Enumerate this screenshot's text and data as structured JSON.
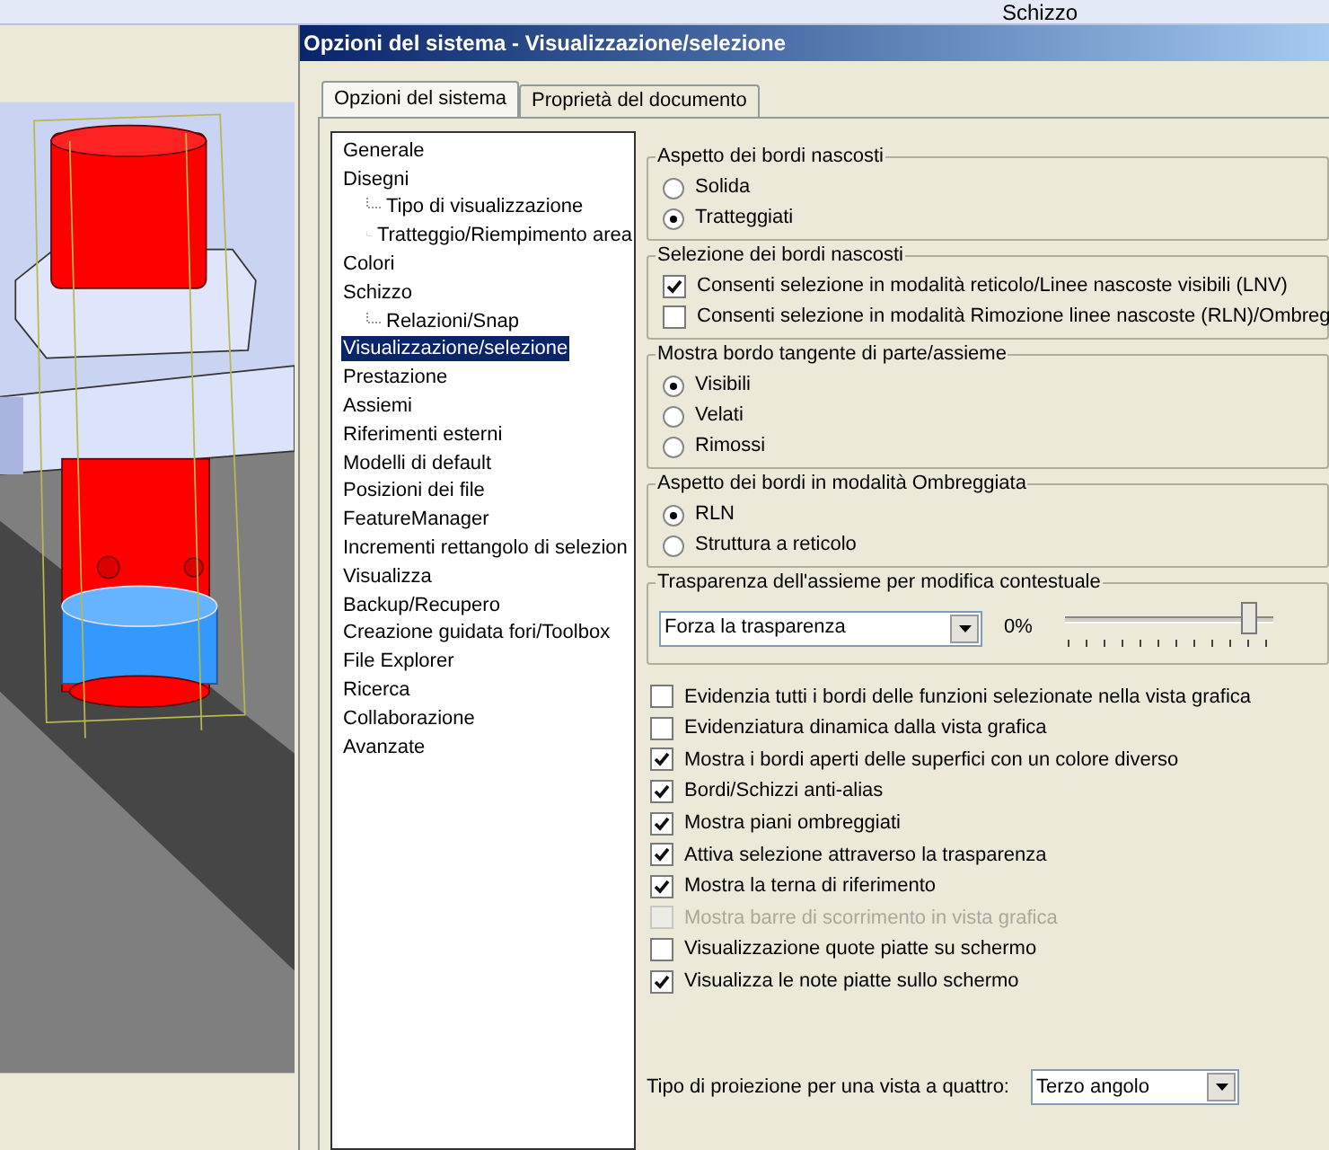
{
  "toolbar": {
    "mode_label": "Schizzo"
  },
  "dialog": {
    "title": "Opzioni del sistema - Visualizzazione/selezione",
    "tabs": [
      {
        "label": "Opzioni del sistema",
        "selected": true
      },
      {
        "label": "Proprietà del documento",
        "selected": false
      }
    ],
    "tree": [
      {
        "label": "Generale",
        "selected": false
      },
      {
        "label": "Disegni",
        "selected": false,
        "children": [
          {
            "label": "Tipo di visualizzazione",
            "selected": false
          },
          {
            "label": "Tratteggio/Riempimento area",
            "selected": false
          }
        ]
      },
      {
        "label": "Colori",
        "selected": false
      },
      {
        "label": "Schizzo",
        "selected": false,
        "children": [
          {
            "label": "Relazioni/Snap",
            "selected": false
          }
        ]
      },
      {
        "label": "Visualizzazione/selezione",
        "selected": true
      },
      {
        "label": "Prestazione",
        "selected": false
      },
      {
        "label": "Assiemi",
        "selected": false
      },
      {
        "label": "Riferimenti esterni",
        "selected": false
      },
      {
        "label": "Modelli di default",
        "selected": false
      },
      {
        "label": "Posizioni dei file",
        "selected": false
      },
      {
        "label": "FeatureManager",
        "selected": false
      },
      {
        "label": "Incrementi rettangolo di selezion",
        "selected": false
      },
      {
        "label": "Visualizza",
        "selected": false
      },
      {
        "label": "Backup/Recupero",
        "selected": false
      },
      {
        "label": "Creazione guidata fori/Toolbox",
        "selected": false
      },
      {
        "label": "File Explorer",
        "selected": false
      },
      {
        "label": "Ricerca",
        "selected": false
      },
      {
        "label": "Collaborazione",
        "selected": false
      },
      {
        "label": "Avanzate",
        "selected": false
      }
    ],
    "groups": [
      {
        "kind": "radio",
        "title": "Aspetto dei bordi nascosti",
        "options": [
          {
            "label": "Solida",
            "selected": false
          },
          {
            "label": "Tratteggiati",
            "selected": true
          }
        ]
      },
      {
        "kind": "checkbox",
        "title": "Selezione dei bordi nascosti",
        "options": [
          {
            "label": "Consenti selezione in modalità reticolo/Linee nascoste visibili (LNV)",
            "checked": true
          },
          {
            "label": "Consenti selezione in modalità Rimozione linee nascoste (RLN)/Ombreg",
            "checked": false
          }
        ]
      },
      {
        "kind": "radio",
        "title": "Mostra bordo tangente di parte/assieme",
        "options": [
          {
            "label": "Visibili",
            "selected": true
          },
          {
            "label": "Velati",
            "selected": false
          },
          {
            "label": "Rimossi",
            "selected": false
          }
        ]
      },
      {
        "kind": "radio",
        "title": "Aspetto dei bordi in modalità Ombreggiata",
        "options": [
          {
            "label": "RLN",
            "selected": true
          },
          {
            "label": "Struttura a reticolo",
            "selected": false
          }
        ]
      },
      {
        "kind": "transparency",
        "title": "Trasparenza dell'assieme per modifica contestuale",
        "dropdown": "Forza la trasparenza",
        "reading": "0%",
        "level": 0.88
      }
    ],
    "checks": [
      {
        "label": "Evidenzia tutti i bordi delle funzioni selezionate nella vista grafica",
        "checked": false,
        "disabled": false
      },
      {
        "label": "Evidenziatura dinamica dalla vista grafica",
        "checked": false,
        "disabled": false
      },
      {
        "label": "Mostra i bordi aperti delle superfici con un colore diverso",
        "checked": true,
        "disabled": false
      },
      {
        "label": "Bordi/Schizzi anti-alias",
        "checked": true,
        "disabled": false
      },
      {
        "label": "Mostra piani ombreggiati",
        "checked": true,
        "disabled": false
      },
      {
        "label": "Attiva selezione attraverso la trasparenza",
        "checked": true,
        "disabled": false
      },
      {
        "label": "Mostra la terna di riferimento",
        "checked": true,
        "disabled": false
      },
      {
        "label": "Mostra barre di scorrimento in vista grafica",
        "checked": false,
        "disabled": true
      },
      {
        "label": "Visualizzazione quote piatte su schermo",
        "checked": false,
        "disabled": false
      },
      {
        "label": "Visualizza le note piatte sullo schermo",
        "checked": true,
        "disabled": false
      }
    ],
    "projection": {
      "label": "Tipo di proiezione per una vista a quattro:",
      "value": "Terzo angolo"
    }
  }
}
